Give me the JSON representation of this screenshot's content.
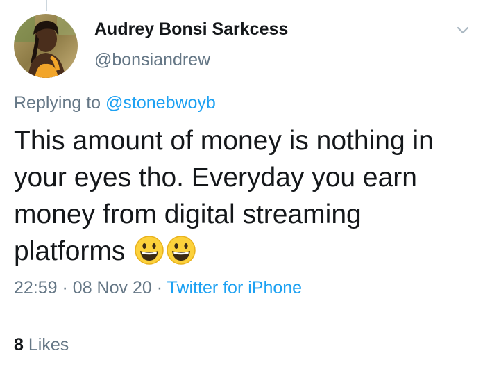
{
  "tweet": {
    "author": {
      "display_name": "Audrey Bonsi Sarkcess",
      "handle": "@bonsiandrew"
    },
    "replying_prefix": "Replying to",
    "replying_to": "@stonebwoyb",
    "text": "This amount of money is nothing in your eyes tho. Everyday you earn money from digital streaming platforms",
    "emojis": [
      "grinning-face-emoji",
      "grinning-face-emoji"
    ],
    "time": "22:59",
    "separator": "·",
    "date": "08 Nov 20",
    "source": "Twitter for iPhone",
    "likes_count": "8",
    "likes_label": "Likes"
  },
  "icons": {
    "menu": "chevron-down-icon"
  },
  "colors": {
    "link": "#1da1f2",
    "secondary_text": "#657786",
    "primary_text": "#14171a",
    "divider": "#e1e8ed"
  }
}
